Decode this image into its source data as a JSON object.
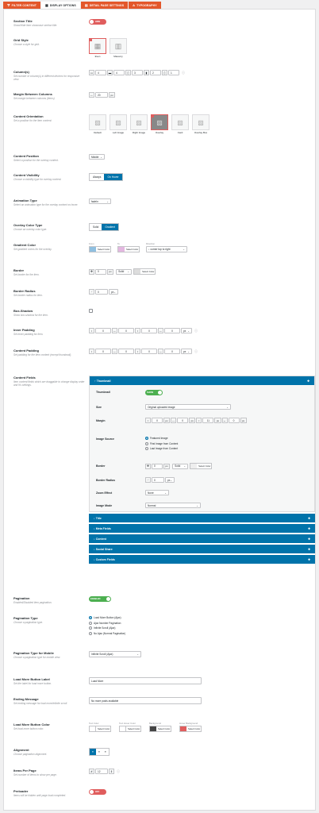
{
  "tabs": [
    {
      "label": "FILTER CONTENT",
      "icon": "filter-icon"
    },
    {
      "label": "DISPLAY OPTIONS",
      "icon": "grid-icon"
    },
    {
      "label": "DETAIL PAGE SETTINGS",
      "icon": "page-icon"
    },
    {
      "label": "TYPOGRAPHY",
      "icon": "type-icon"
    }
  ],
  "section_title": {
    "label": "Section Title",
    "desc": "Show/Hide item showcase section title.",
    "toggle": "HIDE"
  },
  "grid_style": {
    "label": "Grid Style",
    "desc": "Choose a style for grid.",
    "options": [
      "Even",
      "Masonry"
    ]
  },
  "columns": {
    "label": "Column(s)",
    "desc": "Set number of column(s) in different devices for responsive view.",
    "values": [
      "4",
      "4",
      "3",
      "2",
      "1"
    ]
  },
  "margin_columns": {
    "label": "Margin Between Columns",
    "desc": "Set margin between columns (items)",
    "value": "20",
    "unit": "px"
  },
  "content_orientation": {
    "label": "Content Orientation",
    "desc": "Set a position for the item content.",
    "options": [
      "Default",
      "Left Image",
      "Right Image",
      "Overlay",
      "Card",
      "Overlay Box"
    ]
  },
  "content_position": {
    "label": "Content Position",
    "desc": "Select a position for the overlay content.",
    "value": "Middle"
  },
  "content_visibility": {
    "label": "Content Visibility",
    "desc": "Choose a visibility type for overlay content.",
    "options": [
      "Always",
      "On Hover"
    ]
  },
  "animation_type": {
    "label": "Animation Type",
    "desc": "Select an animation type for the overlay content on hover.",
    "value": "fadeIn"
  },
  "overlay_color_type": {
    "label": "Overlay Color Type",
    "desc": "Choose an overlay color type.",
    "options": [
      "Solid",
      "Gradient"
    ]
  },
  "gradient_color": {
    "label": "Gradient Color",
    "desc": "Set gradient colors for the overlay.",
    "from_label": "From",
    "to_label": "To",
    "direction_label": "Direction",
    "select_color": "Select Color",
    "direction": "↓ corner top to right",
    "from_color": "#8fbfe0",
    "to_color": "#e3b7e0"
  },
  "border": {
    "label": "Border",
    "desc": "Set border for the item.",
    "width": "0",
    "unit": "px",
    "style": "Solid",
    "select_color": "Select Color",
    "color": "#dddddd"
  },
  "border_radius": {
    "label": "Border Radius",
    "desc": "Set border radius for item.",
    "value": "0",
    "unit": "px"
  },
  "box_shadow": {
    "label": "Box-Shadow",
    "desc": "Show box-shadow for the item."
  },
  "inner_padding": {
    "label": "Inner Padding",
    "desc": "Set inner padding for item.",
    "values": [
      "0",
      "0",
      "0",
      "0"
    ],
    "unit": "px"
  },
  "content_padding": {
    "label": "Content Padding",
    "desc": "Set padding for the item content (except thumbnail).",
    "values": [
      "0",
      "0",
      "0",
      "0"
    ],
    "unit": "px"
  },
  "content_fields": {
    "label": "Content Fields",
    "desc": "Item content fields which are draggable to change display order and it's settings.",
    "thumbnail": {
      "header": "Thumbnail",
      "thumb_label": "Thumbnail",
      "thumb_toggle": "SHOW",
      "size_label": "Size",
      "size_value": "Original uploaded image",
      "margin_label": "Margin",
      "margin_values": [
        "0",
        "0",
        "11",
        "0"
      ],
      "unit": "px",
      "image_source_label": "Image Source",
      "image_source_options": [
        "Featured Image",
        "First Image from Content",
        "Last Image from Content"
      ],
      "border_label": "Border",
      "border_width": "0",
      "border_style": "Solid",
      "select_color": "Select Color",
      "radius_label": "Border Radius",
      "radius_value": "0",
      "zoom_label": "Zoom Effect",
      "zoom_value": "None",
      "mode_label": "Image Mode",
      "mode_value": "Normal"
    },
    "others": [
      "Title",
      "Meta Fields",
      "Content",
      "Social Share",
      "Custom Fields"
    ]
  },
  "pagination": {
    "label": "Pagination",
    "desc": "Enabled/Disabled item pagination.",
    "toggle": "ENABLED"
  },
  "pagination_type": {
    "label": "Pagination Type",
    "desc": "Choose a pagination type.",
    "options": [
      "Load More Button (Ajax)",
      "Ajax Number Pagination",
      "Infinite Scroll (Ajax)",
      "No Ajax (Normal Pagination)"
    ]
  },
  "pagination_mobile": {
    "label": "Pagination Type for Mobile",
    "desc": "Choose a pagination type for mobile view.",
    "value": "Infinite Scroll (Ajax)"
  },
  "load_more_label": {
    "label": "Load More Button Label",
    "desc": "Set the label for load more button.",
    "value": "Load More"
  },
  "ending_message": {
    "label": "Ending Message",
    "desc": "Set ending message for load more/infinite scroll.",
    "value": "No more posts available"
  },
  "load_more_color": {
    "label": "Load More Button Color",
    "desc": "Set load more button color.",
    "labels": [
      "Text Color",
      "Text Hover Color",
      "Background",
      "Hover Background"
    ],
    "select_color": "Select Color",
    "colors": [
      "#ffffff",
      "#ffffff",
      "#444444",
      "#e05d5d"
    ]
  },
  "alignment": {
    "label": "Alignment",
    "desc": "Choose pagination alignment."
  },
  "items_per_page": {
    "label": "Items Per Page",
    "desc": "Set number of items to show per page.",
    "value": "12"
  },
  "preloader": {
    "label": "Preloader",
    "desc": "Items will be hidden until page load completed.",
    "toggle": "OFF"
  }
}
